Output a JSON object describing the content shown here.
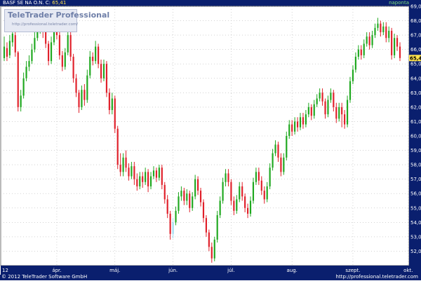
{
  "header": {
    "symbol_label": "BASF SE NA O.N.",
    "close_label": "C:",
    "close_value": "65,41",
    "period": "naponta"
  },
  "logo": {
    "title": "TeleTrader Professional",
    "url": "http://professional.teletrader.com/"
  },
  "footer": {
    "copyright": "© 2012 TeleTrader Software GmbH",
    "url": "http://professional.teletrader.com"
  },
  "colors": {
    "up": "#1fa81f",
    "down": "#e0202a",
    "highlight": "#9fd9f0",
    "grid": "#b8b8b8",
    "bar": "#0a1f6e",
    "price_tag": "#ffe34d"
  },
  "chart_data": {
    "type": "candlestick",
    "ylim": [
      51,
      69
    ],
    "y_ticks": [
      "52,00",
      "53,00",
      "54,00",
      "55,00",
      "56,00",
      "57,00",
      "58,00",
      "59,00",
      "60,00",
      "61,00",
      "62,00",
      "63,00",
      "64,00",
      "65,00",
      "66,00",
      "67,00",
      "68,00",
      "69,00"
    ],
    "x_ticks": [
      {
        "label": "12",
        "index": 0
      },
      {
        "label": "ápr.",
        "index": 19
      },
      {
        "label": "máj.",
        "index": 40
      },
      {
        "label": "jún.",
        "index": 61
      },
      {
        "label": "júl.",
        "index": 82
      },
      {
        "label": "aug.",
        "index": 104
      },
      {
        "label": "szept.",
        "index": 126
      },
      {
        "label": "okt.",
        "index": 146
      }
    ],
    "last_price": {
      "label": "65,41",
      "value": 65.41
    },
    "candles": [
      {
        "o": 65.4,
        "c": 66.2,
        "h": 66.9,
        "l": 65.2
      },
      {
        "o": 66.1,
        "c": 65.5,
        "h": 66.5,
        "l": 65.2
      },
      {
        "o": 65.6,
        "c": 66.6,
        "h": 67.0,
        "l": 65.4
      },
      {
        "o": 66.5,
        "c": 67.1,
        "h": 67.4,
        "l": 66.2
      },
      {
        "o": 67.0,
        "c": 65.8,
        "h": 67.2,
        "l": 65.5
      },
      {
        "o": 65.8,
        "c": 62.0,
        "h": 65.9,
        "l": 61.7
      },
      {
        "o": 62.0,
        "c": 62.8,
        "h": 63.2,
        "l": 61.7
      },
      {
        "o": 62.8,
        "c": 64.0,
        "h": 64.4,
        "l": 62.6
      },
      {
        "o": 64.0,
        "c": 64.8,
        "h": 65.2,
        "l": 63.8
      },
      {
        "o": 64.8,
        "c": 65.2,
        "h": 65.6,
        "l": 64.5
      },
      {
        "o": 65.2,
        "c": 66.0,
        "h": 66.4,
        "l": 65.0
      },
      {
        "o": 66.0,
        "c": 66.8,
        "h": 67.2,
        "l": 65.8
      },
      {
        "o": 66.8,
        "c": 67.4,
        "h": 67.8,
        "l": 66.6
      },
      {
        "o": 67.4,
        "c": 67.8,
        "h": 68.1,
        "l": 67.1
      },
      {
        "o": 67.8,
        "c": 67.2,
        "h": 68.0,
        "l": 66.8
      },
      {
        "o": 67.2,
        "c": 66.4,
        "h": 67.5,
        "l": 66.1
      },
      {
        "o": 66.4,
        "c": 65.2,
        "h": 66.6,
        "l": 64.9
      },
      {
        "o": 65.2,
        "c": 66.5,
        "h": 66.9,
        "l": 65.0
      },
      {
        "o": 66.5,
        "c": 67.6,
        "h": 67.9,
        "l": 66.3
      },
      {
        "o": 67.6,
        "c": 67.0,
        "h": 68.6,
        "l": 66.7
      },
      {
        "o": 67.0,
        "c": 65.6,
        "h": 67.2,
        "l": 65.3
      },
      {
        "o": 65.6,
        "c": 64.8,
        "h": 65.9,
        "l": 64.5
      },
      {
        "o": 64.8,
        "c": 65.8,
        "h": 66.1,
        "l": 64.6
      },
      {
        "o": 65.8,
        "c": 67.0,
        "h": 67.3,
        "l": 65.6
      },
      {
        "o": 67.0,
        "c": 65.5,
        "h": 67.2,
        "l": 65.2
      },
      {
        "o": 65.5,
        "c": 64.0,
        "h": 65.7,
        "l": 63.7
      },
      {
        "o": 64.0,
        "c": 63.0,
        "h": 64.3,
        "l": 62.7
      },
      {
        "o": 63.0,
        "c": 62.0,
        "h": 63.2,
        "l": 61.6
      },
      {
        "o": 62.0,
        "c": 63.2,
        "h": 63.5,
        "l": 61.8
      },
      {
        "o": 63.2,
        "c": 62.5,
        "h": 63.6,
        "l": 62.1
      },
      {
        "o": 62.5,
        "c": 64.2,
        "h": 64.6,
        "l": 62.3
      },
      {
        "o": 64.2,
        "c": 65.5,
        "h": 65.9,
        "l": 64.0
      },
      {
        "o": 65.5,
        "c": 65.2,
        "h": 65.8,
        "l": 64.9
      },
      {
        "o": 65.2,
        "c": 66.2,
        "h": 66.6,
        "l": 65.0
      },
      {
        "o": 66.2,
        "c": 65.0,
        "h": 66.4,
        "l": 64.7
      },
      {
        "o": 65.0,
        "c": 64.0,
        "h": 65.3,
        "l": 63.7
      },
      {
        "o": 64.0,
        "c": 65.0,
        "h": 65.3,
        "l": 63.8
      },
      {
        "o": 65.0,
        "c": 63.0,
        "h": 65.2,
        "l": 62.7
      },
      {
        "o": 63.0,
        "c": 61.8,
        "h": 63.3,
        "l": 61.5
      },
      {
        "o": 61.8,
        "c": 62.6,
        "h": 63.0,
        "l": 61.5
      },
      {
        "o": 62.6,
        "c": 60.5,
        "h": 62.8,
        "l": 60.2
      },
      {
        "o": 60.5,
        "c": 58.0,
        "h": 60.7,
        "l": 57.7
      },
      {
        "o": 58.0,
        "c": 57.5,
        "h": 58.8,
        "l": 57.2
      },
      {
        "o": 57.5,
        "c": 58.5,
        "h": 58.8,
        "l": 57.2
      },
      {
        "o": 58.5,
        "c": 57.8,
        "h": 59.0,
        "l": 57.5
      },
      {
        "o": 57.8,
        "c": 57.2,
        "h": 58.1,
        "l": 56.9
      },
      {
        "o": 57.2,
        "c": 57.9,
        "h": 58.2,
        "l": 57.0
      },
      {
        "o": 57.9,
        "c": 57.0,
        "h": 58.2,
        "l": 56.6
      },
      {
        "o": 57.0,
        "c": 56.5,
        "h": 57.4,
        "l": 56.2
      },
      {
        "o": 56.5,
        "c": 57.2,
        "h": 57.5,
        "l": 56.3
      },
      {
        "o": 57.2,
        "c": 56.8,
        "h": 57.5,
        "l": 56.4
      },
      {
        "o": 56.8,
        "c": 57.5,
        "h": 57.8,
        "l": 56.6
      },
      {
        "o": 57.5,
        "c": 56.5,
        "h": 57.7,
        "l": 56.1
      },
      {
        "o": 56.5,
        "c": 57.2,
        "h": 57.5,
        "l": 56.3
      },
      {
        "o": 57.2,
        "c": 57.6,
        "h": 57.9,
        "l": 57.0
      },
      {
        "o": 57.6,
        "c": 57.1,
        "h": 57.8,
        "l": 56.8
      },
      {
        "o": 57.1,
        "c": 57.8,
        "h": 58.0,
        "l": 56.9
      },
      {
        "o": 57.8,
        "c": 56.6,
        "h": 58.0,
        "l": 56.3
      },
      {
        "o": 56.6,
        "c": 55.6,
        "h": 56.8,
        "l": 55.3
      },
      {
        "o": 55.6,
        "c": 54.6,
        "h": 55.9,
        "l": 54.3
      },
      {
        "o": 54.6,
        "c": 53.2,
        "h": 54.8,
        "l": 52.8
      },
      {
        "o": 53.2,
        "c": 54.0,
        "h": 54.3,
        "l": 52.9,
        "hl": true
      },
      {
        "o": 54.0,
        "c": 54.8,
        "h": 55.1,
        "l": 53.8
      },
      {
        "o": 54.8,
        "c": 55.8,
        "h": 56.1,
        "l": 54.6
      },
      {
        "o": 55.8,
        "c": 56.2,
        "h": 56.5,
        "l": 55.5
      },
      {
        "o": 56.2,
        "c": 55.5,
        "h": 56.4,
        "l": 55.2
      },
      {
        "o": 55.5,
        "c": 56.0,
        "h": 56.3,
        "l": 55.2
      },
      {
        "o": 56.0,
        "c": 55.0,
        "h": 56.2,
        "l": 54.7
      },
      {
        "o": 55.0,
        "c": 55.8,
        "h": 56.1,
        "l": 54.8
      },
      {
        "o": 55.8,
        "c": 57.0,
        "h": 57.3,
        "l": 55.6
      },
      {
        "o": 57.0,
        "c": 56.2,
        "h": 57.2,
        "l": 55.9
      },
      {
        "o": 56.2,
        "c": 55.4,
        "h": 56.4,
        "l": 55.1
      },
      {
        "o": 55.4,
        "c": 54.3,
        "h": 55.6,
        "l": 54.0
      },
      {
        "o": 54.3,
        "c": 53.3,
        "h": 54.5,
        "l": 53.0
      },
      {
        "o": 53.3,
        "c": 52.3,
        "h": 53.5,
        "l": 52.0
      },
      {
        "o": 52.3,
        "c": 51.5,
        "h": 52.6,
        "l": 51.2
      },
      {
        "o": 51.5,
        "c": 52.8,
        "h": 53.0,
        "l": 51.3
      },
      {
        "o": 52.8,
        "c": 54.5,
        "h": 54.8,
        "l": 52.6
      },
      {
        "o": 54.5,
        "c": 55.5,
        "h": 55.8,
        "l": 54.3
      },
      {
        "o": 55.5,
        "c": 56.8,
        "h": 57.1,
        "l": 55.3
      },
      {
        "o": 56.8,
        "c": 57.4,
        "h": 57.7,
        "l": 56.5
      },
      {
        "o": 57.4,
        "c": 56.8,
        "h": 57.7,
        "l": 56.5
      },
      {
        "o": 56.8,
        "c": 55.5,
        "h": 57.0,
        "l": 55.2
      },
      {
        "o": 55.5,
        "c": 54.8,
        "h": 55.8,
        "l": 54.5
      },
      {
        "o": 54.8,
        "c": 55.6,
        "h": 55.9,
        "l": 54.6
      },
      {
        "o": 55.6,
        "c": 56.5,
        "h": 56.8,
        "l": 55.4
      },
      {
        "o": 56.5,
        "c": 55.8,
        "h": 56.8,
        "l": 55.5
      },
      {
        "o": 55.8,
        "c": 55.0,
        "h": 56.0,
        "l": 54.7
      },
      {
        "o": 55.0,
        "c": 54.6,
        "h": 55.3,
        "l": 54.3
      },
      {
        "o": 54.6,
        "c": 55.5,
        "h": 55.8,
        "l": 54.4
      },
      {
        "o": 55.5,
        "c": 56.8,
        "h": 57.1,
        "l": 55.3
      },
      {
        "o": 56.8,
        "c": 57.5,
        "h": 57.8,
        "l": 56.6
      },
      {
        "o": 57.5,
        "c": 56.9,
        "h": 57.8,
        "l": 56.6
      },
      {
        "o": 56.9,
        "c": 56.2,
        "h": 57.2,
        "l": 55.9
      },
      {
        "o": 56.2,
        "c": 55.6,
        "h": 56.5,
        "l": 55.3
      },
      {
        "o": 55.6,
        "c": 56.5,
        "h": 56.8,
        "l": 55.4
      },
      {
        "o": 56.5,
        "c": 57.8,
        "h": 58.1,
        "l": 56.3
      },
      {
        "o": 57.8,
        "c": 58.8,
        "h": 59.1,
        "l": 57.6
      },
      {
        "o": 58.8,
        "c": 59.4,
        "h": 59.7,
        "l": 58.6
      },
      {
        "o": 59.4,
        "c": 58.5,
        "h": 59.6,
        "l": 58.2
      },
      {
        "o": 58.5,
        "c": 57.5,
        "h": 58.8,
        "l": 57.2
      },
      {
        "o": 57.5,
        "c": 58.5,
        "h": 58.8,
        "l": 57.3
      },
      {
        "o": 58.5,
        "c": 60.0,
        "h": 60.3,
        "l": 58.3
      },
      {
        "o": 60.0,
        "c": 60.8,
        "h": 61.1,
        "l": 59.8
      },
      {
        "o": 60.8,
        "c": 60.3,
        "h": 61.1,
        "l": 60.0
      },
      {
        "o": 60.3,
        "c": 61.0,
        "h": 61.3,
        "l": 60.1
      },
      {
        "o": 61.0,
        "c": 60.6,
        "h": 61.3,
        "l": 60.3
      },
      {
        "o": 60.6,
        "c": 61.3,
        "h": 61.6,
        "l": 60.4
      },
      {
        "o": 61.3,
        "c": 60.8,
        "h": 61.6,
        "l": 60.5
      },
      {
        "o": 60.8,
        "c": 61.5,
        "h": 61.8,
        "l": 60.6
      },
      {
        "o": 61.5,
        "c": 62.0,
        "h": 62.3,
        "l": 61.3
      },
      {
        "o": 62.0,
        "c": 61.4,
        "h": 62.2,
        "l": 61.1
      },
      {
        "o": 61.4,
        "c": 62.2,
        "h": 62.5,
        "l": 61.2
      },
      {
        "o": 62.2,
        "c": 62.6,
        "h": 62.9,
        "l": 62.0
      },
      {
        "o": 62.6,
        "c": 63.0,
        "h": 63.3,
        "l": 62.4
      },
      {
        "o": 63.0,
        "c": 62.4,
        "h": 63.3,
        "l": 62.1
      },
      {
        "o": 62.4,
        "c": 61.5,
        "h": 62.6,
        "l": 61.2
      },
      {
        "o": 61.5,
        "c": 62.5,
        "h": 62.8,
        "l": 61.3
      },
      {
        "o": 62.5,
        "c": 63.0,
        "h": 63.3,
        "l": 62.3
      },
      {
        "o": 63.0,
        "c": 62.0,
        "h": 63.2,
        "l": 61.7
      },
      {
        "o": 62.0,
        "c": 61.2,
        "h": 62.3,
        "l": 60.9
      },
      {
        "o": 61.2,
        "c": 62.0,
        "h": 62.3,
        "l": 61.0
      },
      {
        "o": 62.0,
        "c": 61.5,
        "h": 62.3,
        "l": 60.6
      },
      {
        "o": 61.5,
        "c": 60.8,
        "h": 61.8,
        "l": 60.5
      },
      {
        "o": 60.8,
        "c": 62.5,
        "h": 62.8,
        "l": 60.6
      },
      {
        "o": 62.5,
        "c": 63.8,
        "h": 64.1,
        "l": 62.3
      },
      {
        "o": 63.8,
        "c": 64.6,
        "h": 64.9,
        "l": 63.6
      },
      {
        "o": 64.6,
        "c": 65.5,
        "h": 65.8,
        "l": 64.4
      },
      {
        "o": 65.5,
        "c": 66.0,
        "h": 66.3,
        "l": 65.3
      },
      {
        "o": 66.0,
        "c": 65.6,
        "h": 66.3,
        "l": 65.3
      },
      {
        "o": 65.6,
        "c": 66.4,
        "h": 66.7,
        "l": 65.4
      },
      {
        "o": 66.4,
        "c": 66.9,
        "h": 67.2,
        "l": 66.2
      },
      {
        "o": 66.9,
        "c": 66.3,
        "h": 67.2,
        "l": 66.0
      },
      {
        "o": 66.3,
        "c": 67.0,
        "h": 67.3,
        "l": 66.1
      },
      {
        "o": 67.0,
        "c": 67.5,
        "h": 67.8,
        "l": 66.8
      },
      {
        "o": 67.5,
        "c": 67.8,
        "h": 68.2,
        "l": 67.3
      },
      {
        "o": 67.8,
        "c": 67.2,
        "h": 68.0,
        "l": 66.9
      },
      {
        "o": 67.2,
        "c": 67.6,
        "h": 67.9,
        "l": 67.0
      },
      {
        "o": 67.6,
        "c": 66.8,
        "h": 67.9,
        "l": 66.5
      },
      {
        "o": 66.8,
        "c": 67.3,
        "h": 67.6,
        "l": 66.5
      },
      {
        "o": 67.3,
        "c": 65.6,
        "h": 67.5,
        "l": 65.3
      },
      {
        "o": 65.6,
        "c": 66.8,
        "h": 67.1,
        "l": 65.4
      },
      {
        "o": 66.8,
        "c": 66.2,
        "h": 67.0,
        "l": 65.9
      },
      {
        "o": 66.2,
        "c": 65.41,
        "h": 66.5,
        "l": 65.2
      }
    ]
  }
}
